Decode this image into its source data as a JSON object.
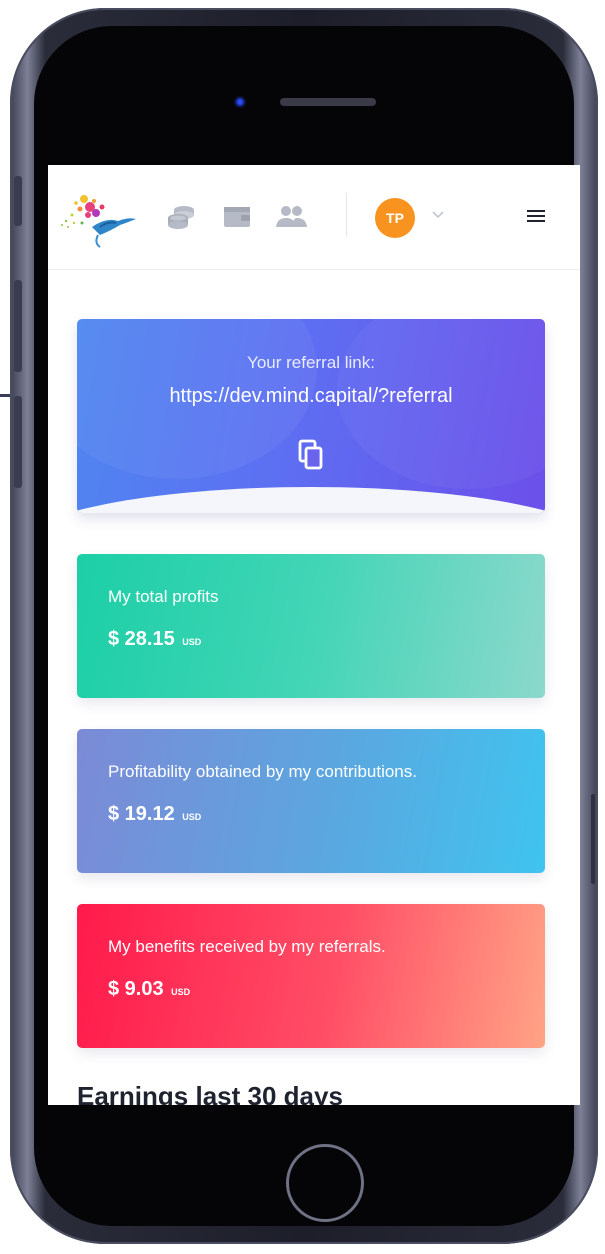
{
  "header": {
    "avatar_initials": "TP",
    "nav_icons": [
      "coins-icon",
      "wallet-icon",
      "users-icon"
    ],
    "menu_icon": "hamburger-menu-icon"
  },
  "referral": {
    "title": "Your referral link:",
    "link": "https://dev.mind.capital/?referral",
    "copy_icon": "copy-icon"
  },
  "stats": [
    {
      "label": "My total profits",
      "amount": "$ 28.15",
      "currency": "USD"
    },
    {
      "label": "Profitability obtained by my contributions.",
      "amount": "$ 19.12",
      "currency": "USD"
    },
    {
      "label": "My benefits received by my referrals.",
      "amount": "$ 9.03",
      "currency": "USD"
    }
  ],
  "section": {
    "title": "Earnings last 30 days"
  },
  "colors": {
    "avatar": "#f7931e",
    "referral_card": "#5d6ff2",
    "profits_card": "#1ccfa6",
    "contributions_card": "#5ba7e0",
    "referrals_card": "#ff1a4b"
  }
}
